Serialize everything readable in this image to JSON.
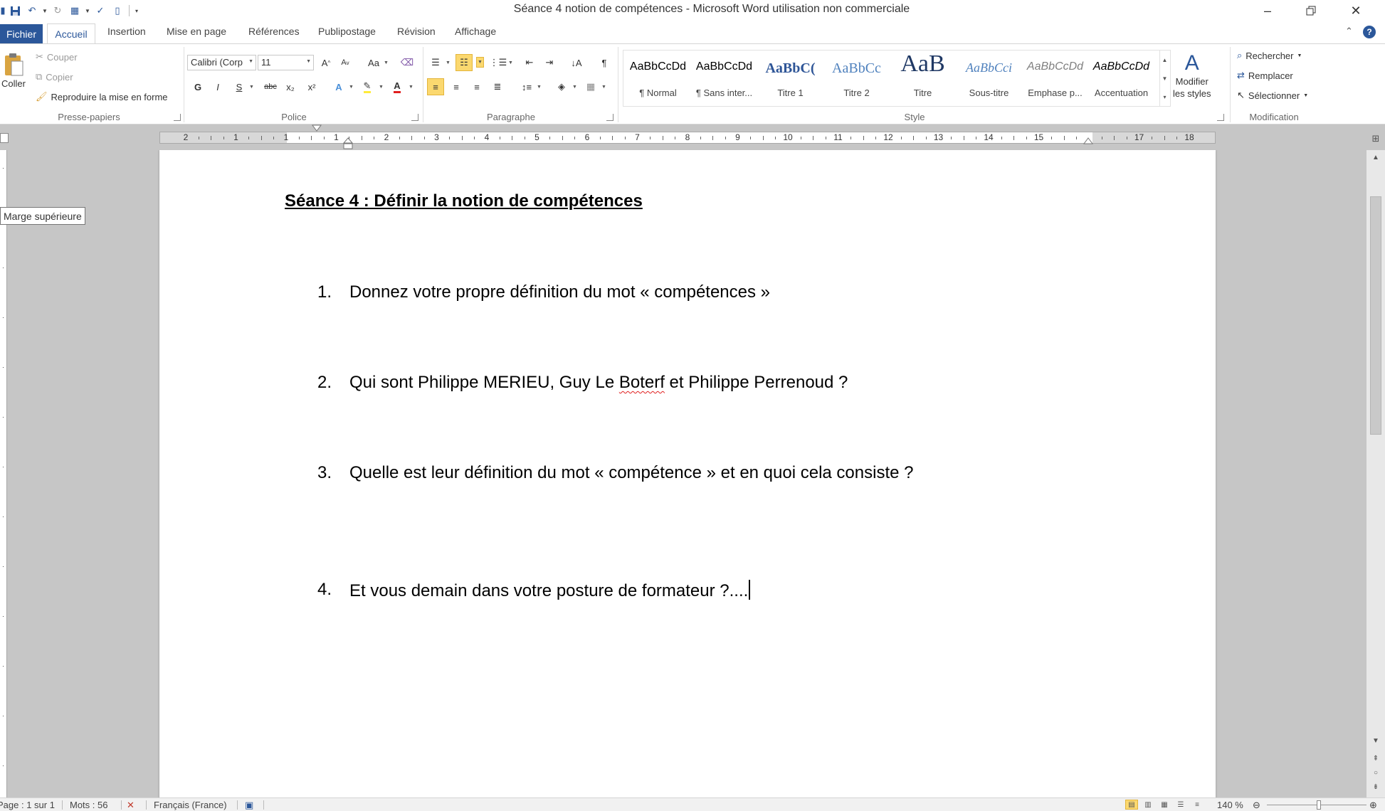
{
  "window": {
    "title": "Séance 4 notion de compétences  -  Microsoft Word utilisation non commerciale"
  },
  "tabs": {
    "file": "Fichier",
    "home": "Accueil",
    "insert": "Insertion",
    "layout": "Mise en page",
    "references": "Références",
    "mailings": "Publipostage",
    "review": "Révision",
    "view": "Affichage"
  },
  "clipboard": {
    "paste": "Coller",
    "cut": "Couper",
    "copy": "Copier",
    "format_painter": "Reproduire la mise en forme",
    "label": "Presse-papiers"
  },
  "font": {
    "name": "Calibri (Corp",
    "size": "11",
    "bold": "G",
    "italic": "I",
    "underline": "S",
    "strike": "abc",
    "subscript": "x₂",
    "superscript": "x²",
    "label": "Police"
  },
  "paragraph": {
    "label": "Paragraphe"
  },
  "styles": {
    "label": "Style",
    "items": [
      {
        "sample": "AaBbCcDd",
        "name": "¶ Normal"
      },
      {
        "sample": "AaBbCcDd",
        "name": "¶ Sans inter..."
      },
      {
        "sample": "AaBbC(",
        "name": "Titre 1"
      },
      {
        "sample": "AaBbCc",
        "name": "Titre 2"
      },
      {
        "sample": "AaB",
        "name": "Titre"
      },
      {
        "sample": "AaBbCci",
        "name": "Sous-titre"
      },
      {
        "sample": "AaBbCcDd",
        "name": "Emphase p..."
      },
      {
        "sample": "AaBbCcDd",
        "name": "Accentuation"
      }
    ],
    "modify_line1": "Modifier",
    "modify_line2": "les styles"
  },
  "editing": {
    "find": "Rechercher",
    "replace": "Remplacer",
    "select": "Sélectionner",
    "label": "Modification"
  },
  "ruler": {
    "numbers": [
      "2",
      "1",
      "1",
      "1",
      "2",
      "3",
      "4",
      "5",
      "6",
      "7",
      "8",
      "9",
      "10",
      "11",
      "12",
      "13",
      "14",
      "15",
      "",
      "17",
      "18"
    ]
  },
  "tooltip": "Marge supérieure",
  "document": {
    "title": "Séance 4 : Définir la notion de compétences",
    "questions": [
      {
        "num": "1.",
        "text": "Donnez votre propre définition du mot « compétences »"
      },
      {
        "num": "2.",
        "text_before": "Qui sont Philippe MERIEU, Guy Le ",
        "text_misspelled": "Boterf",
        "text_after": "  et Philippe Perrenoud ?"
      },
      {
        "num": "3.",
        "text": "Quelle est leur définition du mot « compétence » et en quoi cela consiste ?"
      },
      {
        "num": "4.",
        "text": "Et vous demain dans votre posture de formateur ?...."
      }
    ]
  },
  "status": {
    "page": "Page : 1 sur 1",
    "words": "Mots : 56",
    "language": "Français (France)",
    "zoom": "140 %"
  },
  "colors": {
    "brand": "#2b579a",
    "highlight": "#fbd86f",
    "spell_error": "#e02020"
  }
}
